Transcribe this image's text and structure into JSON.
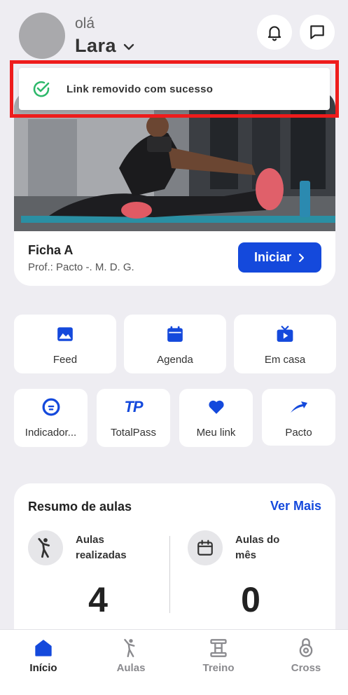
{
  "header": {
    "greeting": "olá",
    "user_name": "Lara"
  },
  "toast": {
    "message": "Link removido com sucesso"
  },
  "workout": {
    "title": "Ficha A",
    "professor": "Prof.: Pacto -. M. D. G.",
    "start_label": "Iniciar"
  },
  "shortcuts_row1": [
    {
      "label": "Feed",
      "icon": "image-icon"
    },
    {
      "label": "Agenda",
      "icon": "calendar-icon"
    },
    {
      "label": "Em casa",
      "icon": "tv-play-icon"
    }
  ],
  "shortcuts_row2": [
    {
      "label": "Indicador...",
      "icon": "indicator-icon"
    },
    {
      "label": "TotalPass",
      "icon": "totalpass-logo-icon",
      "logo_text": "TP"
    },
    {
      "label": "Meu link",
      "icon": "heart-icon"
    },
    {
      "label": "Pacto",
      "icon": "pacto-arrow-icon"
    }
  ],
  "summary": {
    "title": "Resumo de aulas",
    "more_label": "Ver Mais",
    "done": {
      "label_line1": "Aulas",
      "label_line2": "realizadas",
      "value": "4"
    },
    "month": {
      "label_line1": "Aulas do",
      "label_line2": "mês",
      "value": "0"
    }
  },
  "nav": [
    {
      "label": "Início",
      "icon": "home-icon",
      "active": true
    },
    {
      "label": "Aulas",
      "icon": "person-exercise-icon",
      "active": false
    },
    {
      "label": "Treino",
      "icon": "dumbbell-icon",
      "active": false
    },
    {
      "label": "Cross",
      "icon": "kettlebell-icon",
      "active": false
    }
  ],
  "colors": {
    "accent": "#1449dc",
    "background": "#eeedf2",
    "toast_check": "#2db86a",
    "highlight_box": "#ee1c1c"
  }
}
